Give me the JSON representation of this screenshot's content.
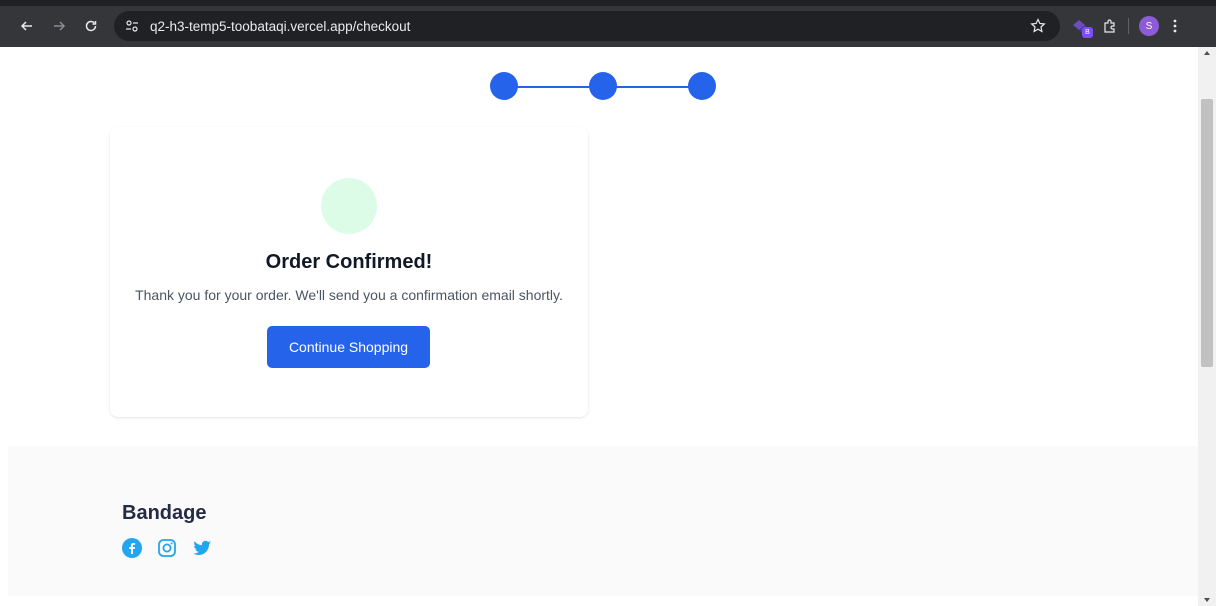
{
  "browser": {
    "url": "q2-h3-temp5-toobataqi.vercel.app/checkout",
    "profile_initial": "S",
    "extension_badge": "B"
  },
  "checkout": {
    "steps": [
      "",
      "",
      ""
    ],
    "confirmation_title": "Order Confirmed!",
    "confirmation_message": "Thank you for your order. We'll send you a confirmation email shortly.",
    "continue_label": "Continue Shopping"
  },
  "footer": {
    "brand": "Bandage",
    "social_icons": [
      "facebook-icon",
      "instagram-icon",
      "twitter-icon"
    ]
  },
  "colors": {
    "accent": "#2563eb",
    "success_bg": "#dcfce7",
    "footer_bg": "#fafafa",
    "brand_text": "#252b42"
  }
}
